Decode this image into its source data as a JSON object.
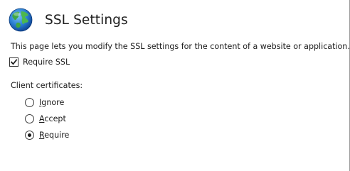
{
  "header": {
    "title": "SSL Settings",
    "icon": "globe-icon"
  },
  "description": "This page lets you modify the SSL settings for the content of a website or application.",
  "require_ssl": {
    "label": "Require SSL",
    "checked": true
  },
  "client_certificates": {
    "label": "Client certificates:",
    "options": [
      {
        "access_key": "I",
        "rest": "gnore",
        "selected": false
      },
      {
        "access_key": "A",
        "rest": "ccept",
        "selected": false
      },
      {
        "access_key": "R",
        "rest": "equire",
        "selected": true
      }
    ],
    "selected": "Require"
  }
}
